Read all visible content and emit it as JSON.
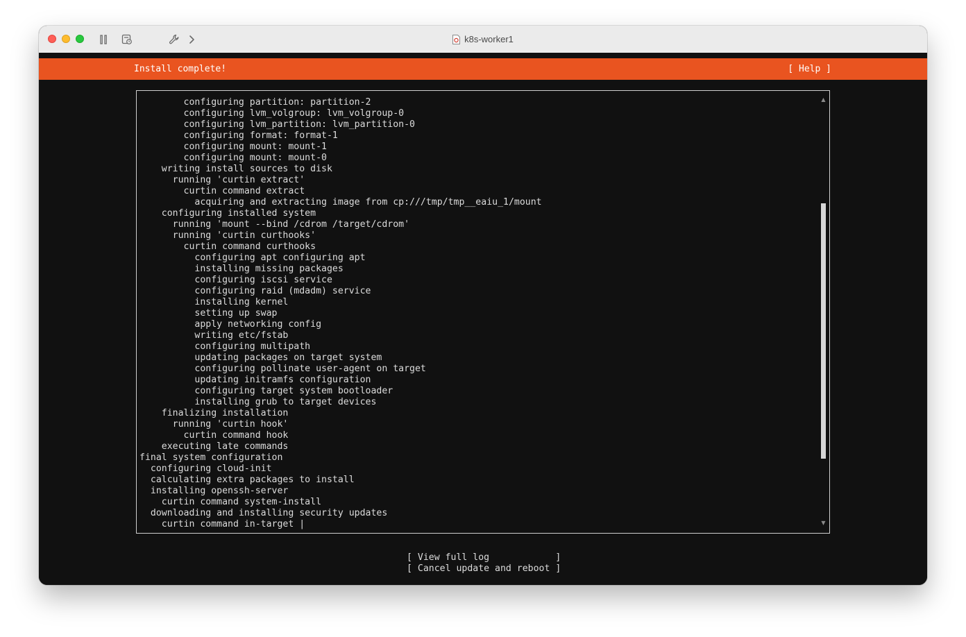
{
  "window": {
    "title": "k8s-worker1"
  },
  "installer": {
    "status_title": "Install complete!",
    "help_label": "[ Help ]",
    "accent_color": "#e95420",
    "log_lines": [
      "        configuring partition: partition-2",
      "        configuring lvm_volgroup: lvm_volgroup-0",
      "        configuring lvm_partition: lvm_partition-0",
      "        configuring format: format-1",
      "        configuring mount: mount-1",
      "        configuring mount: mount-0",
      "    writing install sources to disk",
      "      running 'curtin extract'",
      "        curtin command extract",
      "          acquiring and extracting image from cp:///tmp/tmp__eaiu_1/mount",
      "    configuring installed system",
      "      running 'mount --bind /cdrom /target/cdrom'",
      "      running 'curtin curthooks'",
      "        curtin command curthooks",
      "          configuring apt configuring apt",
      "          installing missing packages",
      "          configuring iscsi service",
      "          configuring raid (mdadm) service",
      "          installing kernel",
      "          setting up swap",
      "          apply networking config",
      "          writing etc/fstab",
      "          configuring multipath",
      "          updating packages on target system",
      "          configuring pollinate user-agent on target",
      "          updating initramfs configuration",
      "          configuring target system bootloader",
      "          installing grub to target devices",
      "    finalizing installation",
      "      running 'curtin hook'",
      "        curtin command hook",
      "    executing late commands",
      "final system configuration",
      "  configuring cloud-init",
      "  calculating extra packages to install",
      "  installing openssh-server",
      "    curtin command system-install",
      "  downloading and installing security updates",
      "    curtin command in-target |"
    ],
    "buttons": {
      "view_log": "[ View full log            ]",
      "cancel_reboot": "[ Cancel update and reboot ]"
    },
    "scroll_position": 0.62
  }
}
